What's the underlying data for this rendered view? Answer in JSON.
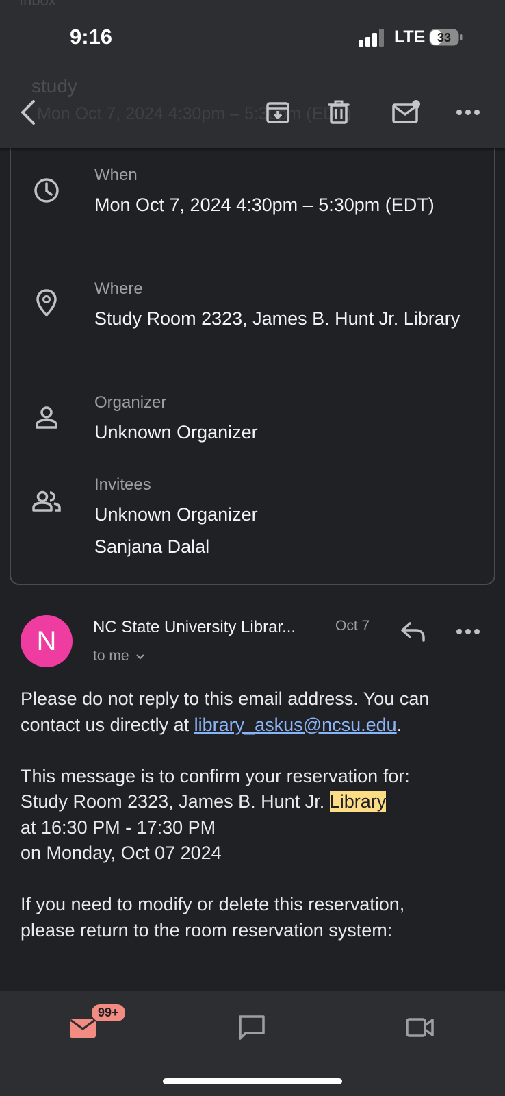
{
  "status_bar": {
    "time": "9:16",
    "network": "LTE",
    "battery": "33"
  },
  "header": {
    "background_text_1": "Inbox",
    "background_title": "study",
    "background_subtitle": "Mon Oct 7, 2024 4:30pm – 5:30pm (EDT)",
    "icons": [
      "back-arrow-icon",
      "archive-icon",
      "delete-icon",
      "mark-unread-icon",
      "more-icon"
    ]
  },
  "event": {
    "when": {
      "label": "When",
      "value": "Mon Oct 7, 2024 4:30pm – 5:30pm (EDT)",
      "icon": "clock-icon"
    },
    "where": {
      "label": "Where",
      "value": "Study Room 2323, James B. Hunt Jr. Library",
      "icon": "location-pin-icon"
    },
    "organizer": {
      "label": "Organizer",
      "value": "Unknown Organizer",
      "icon": "person-icon"
    },
    "invitees": {
      "label": "Invitees",
      "values": [
        "Unknown Organizer",
        "Sanjana Dalal"
      ],
      "icon": "people-icon"
    }
  },
  "message": {
    "avatar_letter": "N",
    "avatar_color": "#ee3ca0",
    "sender": "NC State University Librar...",
    "date": "Oct 7",
    "recipient": "to me",
    "body": {
      "p1_text": "Please do not reply to this email address. You can contact us directly at",
      "p1_link": "library_askus@ncsu.edu",
      "p1_end": ".",
      "p2_line1": "This message is to confirm your reservation for:",
      "p2_line2_a": "Study Room 2323, James B. Hunt Jr.",
      "p2_line2_highlight": "Library",
      "p2_line3": "at 16:30 PM - 17:30 PM",
      "p2_line4": "on Monday, Oct 07 2024",
      "p3_line1": "If you need to modify or delete this reservation,",
      "p3_line2": "please return to the room reservation system:"
    }
  },
  "bottom_nav": {
    "mail_badge": "99+",
    "items": [
      "mail-icon",
      "chat-icon",
      "meet-icon"
    ],
    "accent_color": "#f28b82"
  }
}
